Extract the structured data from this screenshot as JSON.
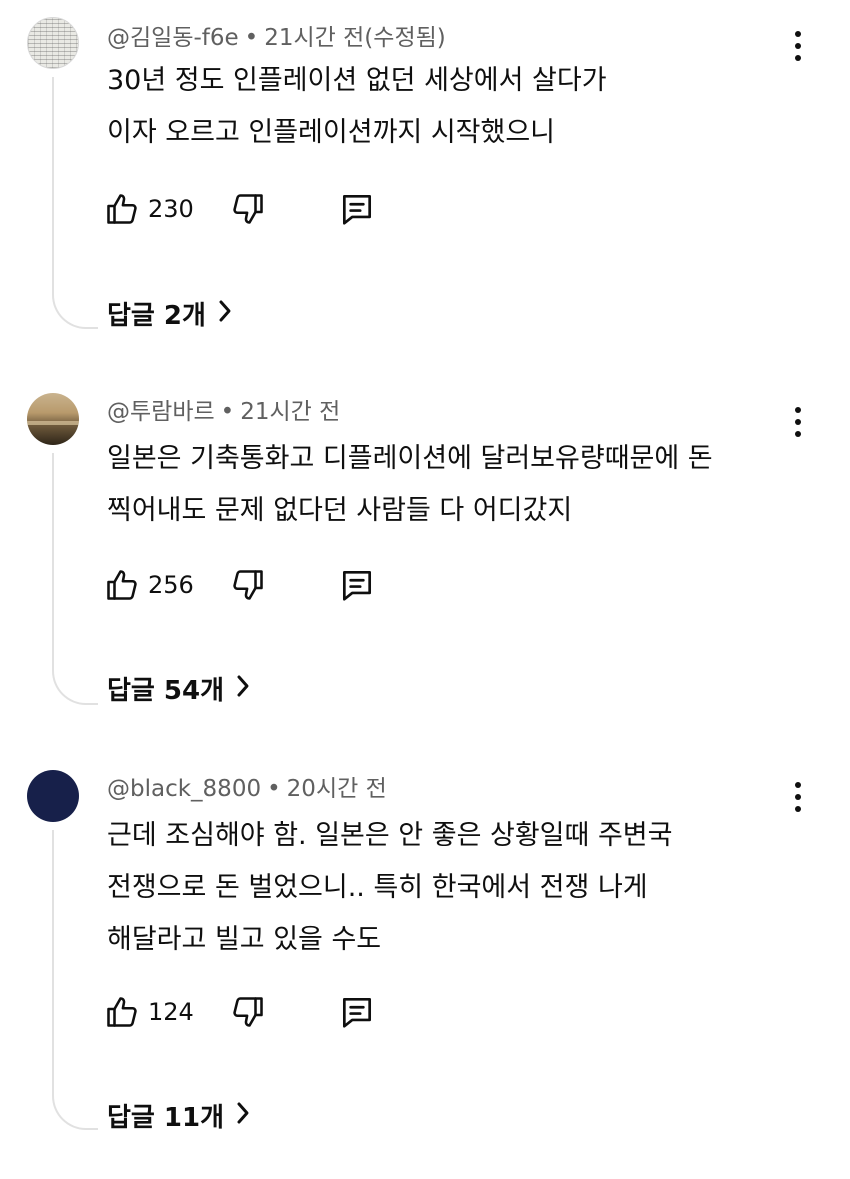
{
  "comments": [
    {
      "handle": "@김일동-f6e",
      "time": "21시간 전(수정됨)",
      "lines": [
        "30년 정도 인플레이션 없던 세상에서 살다가",
        "이자 오르고 인플레이션까지 시작했으니"
      ],
      "likes": "230",
      "replies_label": "답글 2개",
      "avatar": "pattern-avatar"
    },
    {
      "handle": "@투람바르",
      "time": "21시간 전",
      "lines": [
        "일본은 기축통화고 디플레이션에 달러보유량때문에 돈",
        "찍어내도 문제 없다던 사람들 다 어디갔지"
      ],
      "likes": "256",
      "replies_label": "답글 54개",
      "avatar": "sunset-avatar"
    },
    {
      "handle": "@black_8800",
      "time": "20시간 전",
      "lines": [
        "근데 조심해야 함. 일본은 안 좋은 상황일때 주변국",
        "전쟁으로 돈 벌었으니.. 특히 한국에서 전쟁 나게",
        "해달라고 빌고 있을 수도"
      ],
      "likes": "124",
      "replies_label": "답글 11개",
      "avatar": "navy-avatar"
    }
  ],
  "separator": "•",
  "icons": {
    "like": "thumbs-up-icon",
    "dislike": "thumbs-down-icon",
    "reply": "comment-icon",
    "more": "more-vertical-icon",
    "replies": "chevron-right-icon"
  }
}
